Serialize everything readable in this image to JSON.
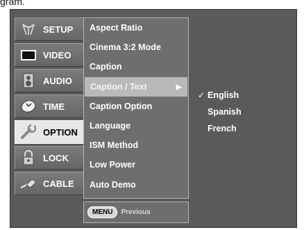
{
  "caption_fragment": "gram.",
  "tabs": [
    {
      "key": "setup",
      "label": "SETUP",
      "icon": "satellite-dish-icon",
      "active": false
    },
    {
      "key": "video",
      "label": "VIDEO",
      "icon": "screen-icon",
      "active": false
    },
    {
      "key": "audio",
      "label": "AUDIO",
      "icon": "speaker-icon",
      "active": false
    },
    {
      "key": "time",
      "label": "TIME",
      "icon": "clock-icon",
      "active": false
    },
    {
      "key": "option",
      "label": "OPTION",
      "icon": "wrench-icon",
      "active": true
    },
    {
      "key": "lock",
      "label": "LOCK",
      "icon": "padlock-icon",
      "active": false
    },
    {
      "key": "cable",
      "label": "CABLE",
      "icon": "cable-plug-icon",
      "active": false
    }
  ],
  "menu": {
    "items": [
      {
        "label": "Aspect Ratio"
      },
      {
        "label": "Cinema 3:2 Mode"
      },
      {
        "label": "Caption"
      },
      {
        "label": "Caption / Text",
        "selected": true,
        "arrow": "▶"
      },
      {
        "label": "Caption Option"
      },
      {
        "label": "Language"
      },
      {
        "label": "ISM Method"
      },
      {
        "label": "Low Power"
      },
      {
        "label": "Auto Demo"
      }
    ]
  },
  "footer": {
    "key_label": "MENU",
    "text": "Previous"
  },
  "submenu": {
    "items": [
      {
        "label": "English",
        "checked": true,
        "check_mark": "✓"
      },
      {
        "label": "Spanish",
        "checked": false,
        "check_mark": ""
      },
      {
        "label": "French",
        "checked": false,
        "check_mark": ""
      }
    ]
  },
  "colors": {
    "panel": "#5a5a5a",
    "active_tab": "#e6e6e6",
    "selected_item": "#b9b9b9"
  }
}
